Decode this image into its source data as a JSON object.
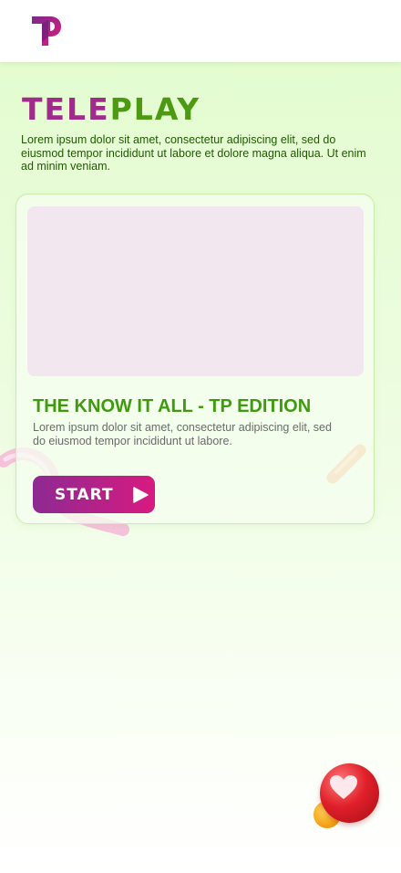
{
  "header": {
    "logo_icon": "teleplay-tp-logo-icon"
  },
  "brand": {
    "part1": "TELE",
    "part2": "PLAY",
    "color1": "#a22a8a",
    "color2": "#4c9a12"
  },
  "intro": {
    "text": "Lorem ipsum dolor sit amet, consectetur adipiscing elit, sed do eiusmod tempor incididunt ut labore et dolore magna aliqua. Ut enim ad minim veniam."
  },
  "game_card": {
    "title": "THE KNOW IT ALL - TP EDITION",
    "description": "Lorem ipsum dolor sit amet, consectetur adipiscing elit, sed do eiusmod tempor incididunt ut labore.",
    "start_label": "START",
    "start_icon": "play-icon",
    "title_color": "#3f9a0f"
  },
  "floating": {
    "icon": "heart-icon"
  },
  "colors": {
    "accent_start": "#8d2a92",
    "accent_end": "#d81a80",
    "background": "#e2fccd"
  }
}
